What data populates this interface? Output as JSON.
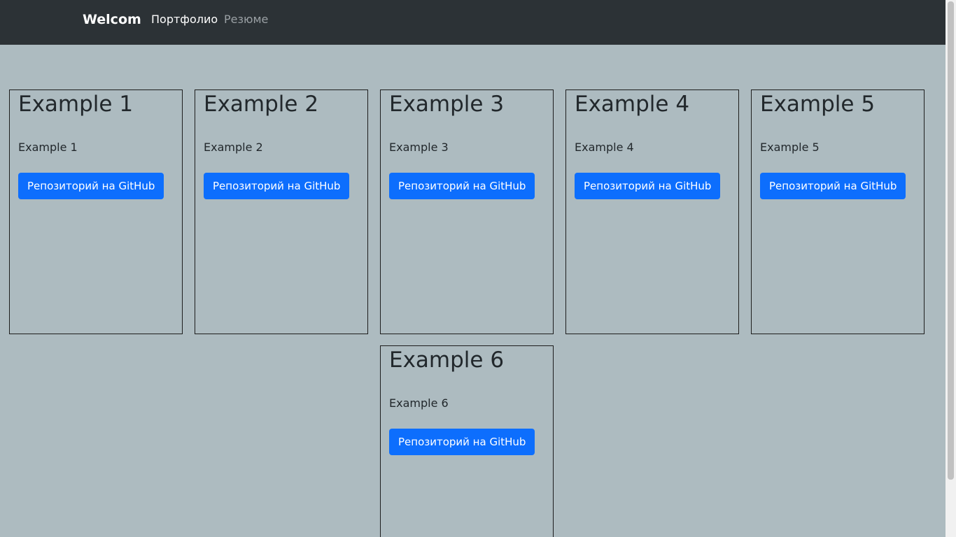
{
  "navbar": {
    "brand": "Welcom",
    "links": [
      {
        "label": "Портфолио",
        "active": true
      },
      {
        "label": "Резюме",
        "active": false
      }
    ]
  },
  "cards": [
    {
      "title": "Example 1",
      "text": "Example 1",
      "button": "Репозиторий на GitHub"
    },
    {
      "title": "Example 2",
      "text": "Example 2",
      "button": "Репозиторий на GitHub"
    },
    {
      "title": "Example 3",
      "text": "Example 3",
      "button": "Репозиторий на GitHub"
    },
    {
      "title": "Example 4",
      "text": "Example 4",
      "button": "Репозиторий на GitHub"
    },
    {
      "title": "Example 5",
      "text": "Example 5",
      "button": "Репозиторий на GitHub"
    },
    {
      "title": "Example 6",
      "text": "Example 6",
      "button": "Репозиторий на GitHub"
    }
  ],
  "colors": {
    "navbar_bg": "#2c3236",
    "page_bg": "#adbbc0",
    "button_bg": "#0d6efd"
  }
}
